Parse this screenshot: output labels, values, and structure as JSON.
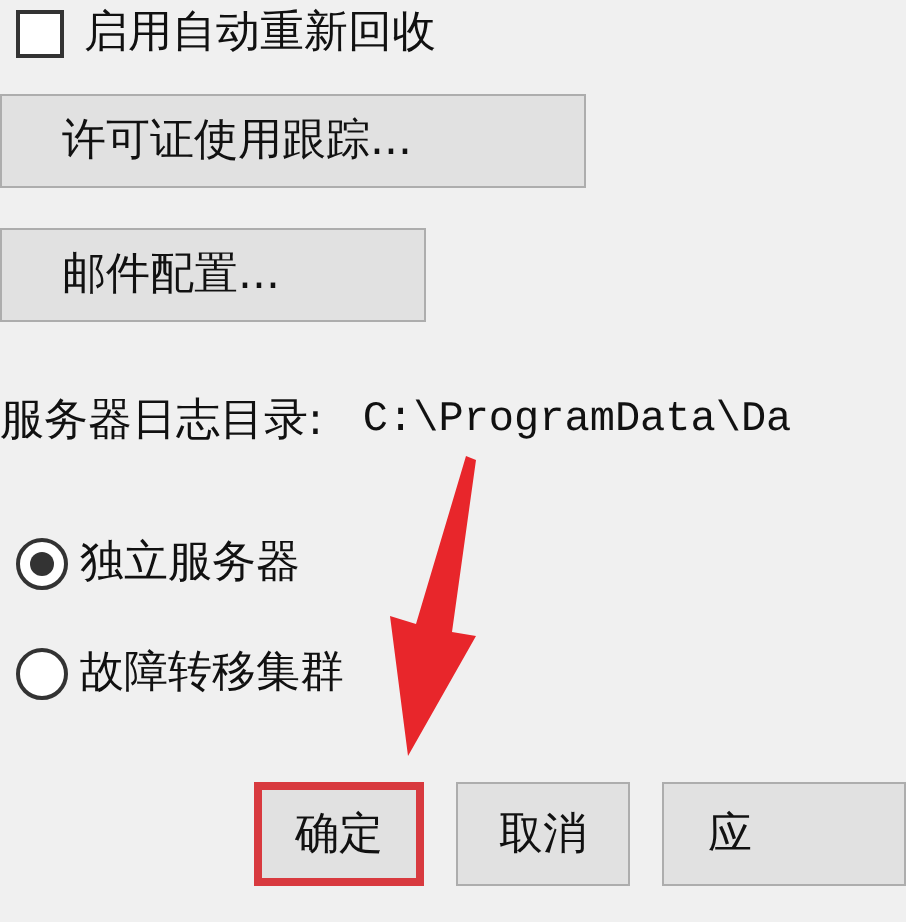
{
  "auto_recycle": {
    "label": "启用自动重新回收",
    "checked": false
  },
  "action_buttons": [
    {
      "label": "许可证使用跟踪..."
    },
    {
      "label": "邮件配置..."
    }
  ],
  "log_directory": {
    "label": "服务器日志目录:",
    "value": "C:\\ProgramData\\Da"
  },
  "server_modes": [
    {
      "label": "独立服务器",
      "selected": true
    },
    {
      "label": "故障转移集群",
      "selected": false
    }
  ],
  "dialog_buttons": [
    {
      "label": "确定",
      "highlighted": true
    },
    {
      "label": "取消",
      "highlighted": false
    },
    {
      "label": "应",
      "highlighted": false
    }
  ]
}
